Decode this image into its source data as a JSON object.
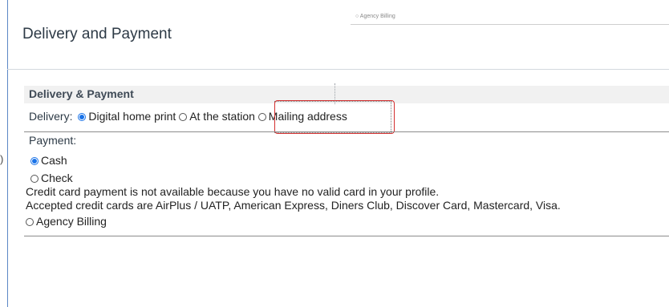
{
  "top_snippet": "○ Agency Billing",
  "title": "Delivery and Payment",
  "section": {
    "heading": "Delivery & Payment"
  },
  "delivery": {
    "label": "Delivery:",
    "options": [
      "Digital home print",
      "At the station",
      "Mailing address"
    ],
    "selected": "Digital home print"
  },
  "payment": {
    "label": "Payment:",
    "options": [
      "Cash",
      "Check",
      "Agency Billing"
    ],
    "selected": "Cash",
    "notes": [
      "Credit card payment is not available because you have no valid card in your profile.",
      "Accepted credit cards are AirPlus / UATP, American Express, Diners Club, Discover Card, Mastercard, Visa."
    ]
  },
  "colors": {
    "accent": "#1a73e8",
    "highlight": "#d32f2f",
    "panel_border": "#5b87c5"
  }
}
